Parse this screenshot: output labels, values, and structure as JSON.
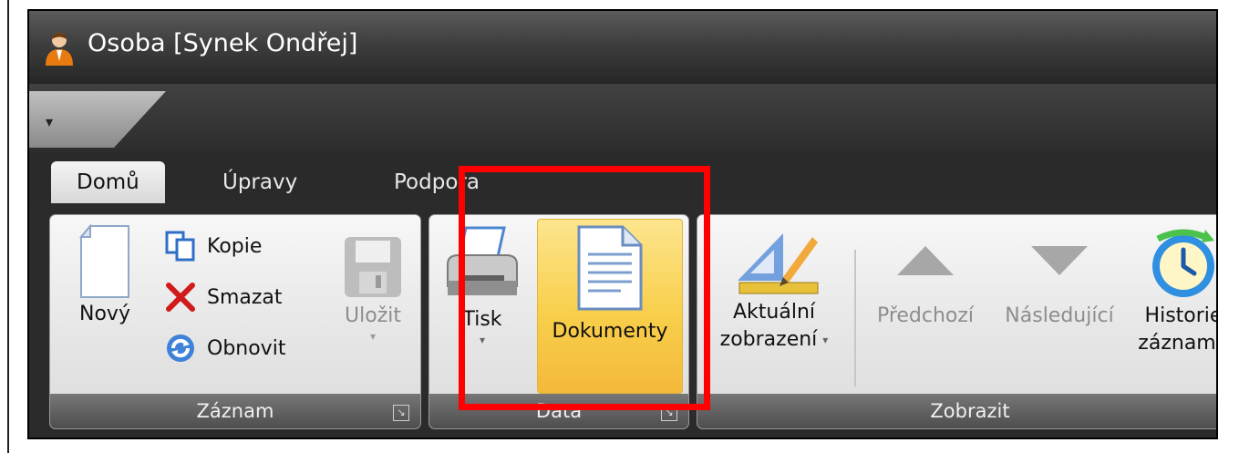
{
  "window": {
    "title": "Osoba [Synek Ondřej]"
  },
  "tabs": [
    {
      "label": "Domů",
      "active": true
    },
    {
      "label": "Úpravy",
      "active": false
    },
    {
      "label": "Podpora",
      "active": false
    }
  ],
  "ribbon": {
    "groups": {
      "zaznam": {
        "label": "Záznam",
        "novy": "Nový",
        "kopie": "Kopie",
        "smazat": "Smazat",
        "obnovit": "Obnovit",
        "ulozit": "Uložit"
      },
      "data": {
        "label": "Data",
        "tisk": "Tisk",
        "dokumenty": "Dokumenty"
      },
      "zobrazit": {
        "label": "Zobrazit",
        "aktualni_line1": "Aktuální",
        "aktualni_line2": "zobrazení",
        "predchozi": "Předchozí",
        "nasledujici": "Následující",
        "historie_line1": "Historie",
        "historie_line2": "záznamu"
      }
    }
  },
  "colors": {
    "highlight": "#ff0000",
    "selected_button": "#f8cf4a"
  }
}
